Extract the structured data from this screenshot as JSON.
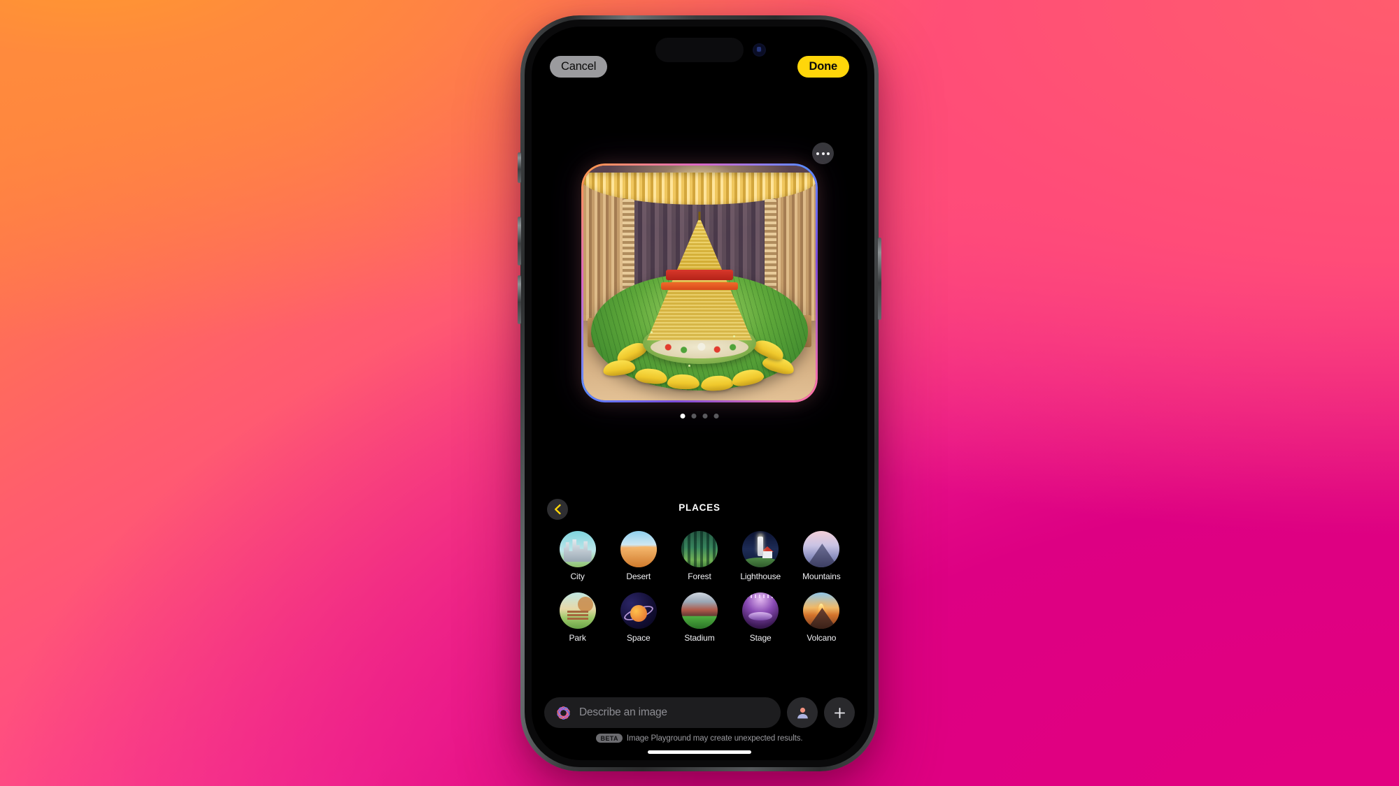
{
  "app": {
    "name": "Image Playground",
    "accent_yellow": "#FFD60A",
    "background_dark": "#000000"
  },
  "top_bar": {
    "cancel_label": "Cancel",
    "done_label": "Done"
  },
  "canvas": {
    "more_options_icon": "ellipsis-icon",
    "image_description": "Generated image of a tall golden conical rice mound with red and orange bands on a green banana leaf surrounded by bananas in a decorated hall",
    "page_dots": {
      "total": 4,
      "active_index": 0
    }
  },
  "category": {
    "back_icon": "chevron-left-icon",
    "title": "PLACES"
  },
  "concepts": [
    {
      "label": "City",
      "art": "th-city"
    },
    {
      "label": "Desert",
      "art": "th-desert"
    },
    {
      "label": "Forest",
      "art": "th-forest"
    },
    {
      "label": "Lighthouse",
      "art": "th-lighthouse"
    },
    {
      "label": "Mountains",
      "art": "th-mountains"
    },
    {
      "label": "Park",
      "art": "th-park"
    },
    {
      "label": "Space",
      "art": "th-space"
    },
    {
      "label": "Stadium",
      "art": "th-stadium"
    },
    {
      "label": "Stage",
      "art": "th-stage"
    },
    {
      "label": "Volcano",
      "art": "th-volcano"
    }
  ],
  "input_bar": {
    "apple_intelligence_icon": "apple-intelligence-icon",
    "placeholder": "Describe an image",
    "value": "",
    "person_button_icon": "person-icon",
    "add_button_icon": "plus-icon"
  },
  "disclaimer": {
    "badge": "BETA",
    "text": "Image Playground may create unexpected results."
  }
}
